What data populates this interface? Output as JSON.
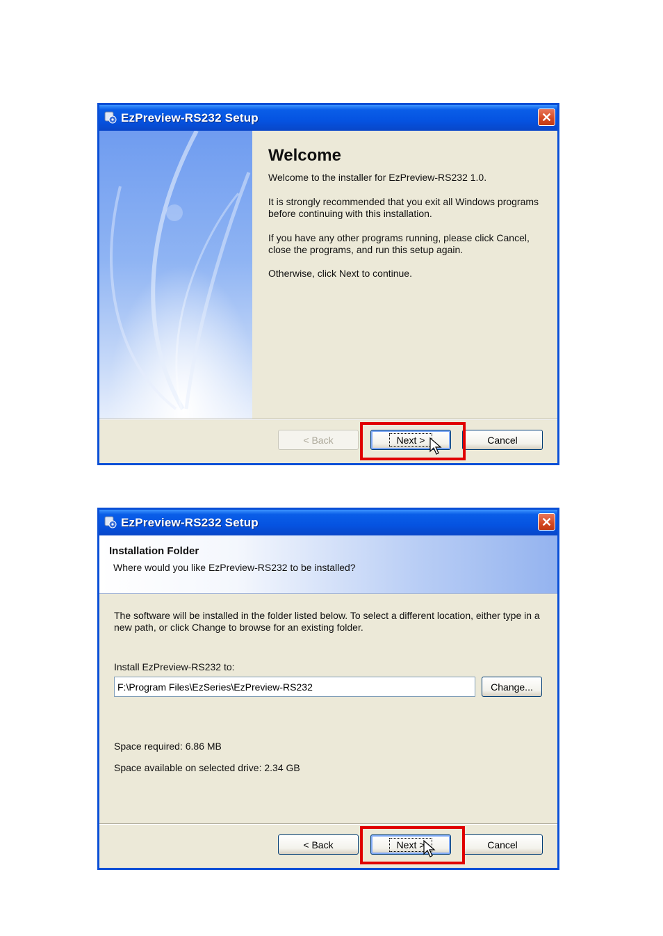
{
  "dialog1": {
    "title": "EzPreview-RS232 Setup",
    "close_glyph": "✕",
    "heading": "Welcome",
    "para1": "Welcome to the installer for EzPreview-RS232 1.0.",
    "para2": "It is strongly recommended that you exit all Windows programs before continuing with this installation.",
    "para3": "If you have any other programs running, please click Cancel, close the programs, and run this setup again.",
    "para4": "Otherwise, click Next to continue.",
    "back_label": "< Back",
    "next_label": "Next >",
    "cancel_label": "Cancel",
    "back_enabled": false
  },
  "dialog2": {
    "title": "EzPreview-RS232 Setup",
    "close_glyph": "✕",
    "header_title": "Installation Folder",
    "header_subtitle": "Where would you like EzPreview-RS232 to be installed?",
    "description": "The software will be installed in the folder listed below. To select a different location, either type in a new path, or click Change to browse for an existing folder.",
    "install_label": "Install EzPreview-RS232 to:",
    "install_path": "F:\\Program Files\\EzSeries\\EzPreview-RS232",
    "change_label": "Change...",
    "space_required": "Space required: 6.86 MB",
    "space_available": "Space available on selected drive: 2.34 GB",
    "back_label": "< Back",
    "next_label": "Next >",
    "cancel_label": "Cancel",
    "back_enabled": true
  },
  "icons": [
    "setup-app-icon",
    "close-icon",
    "mouse-pointer-icon"
  ],
  "colors": {
    "titlebar": "#0553e1",
    "highlight_box": "#e00000",
    "dialog_bg": "#ece9d8"
  }
}
